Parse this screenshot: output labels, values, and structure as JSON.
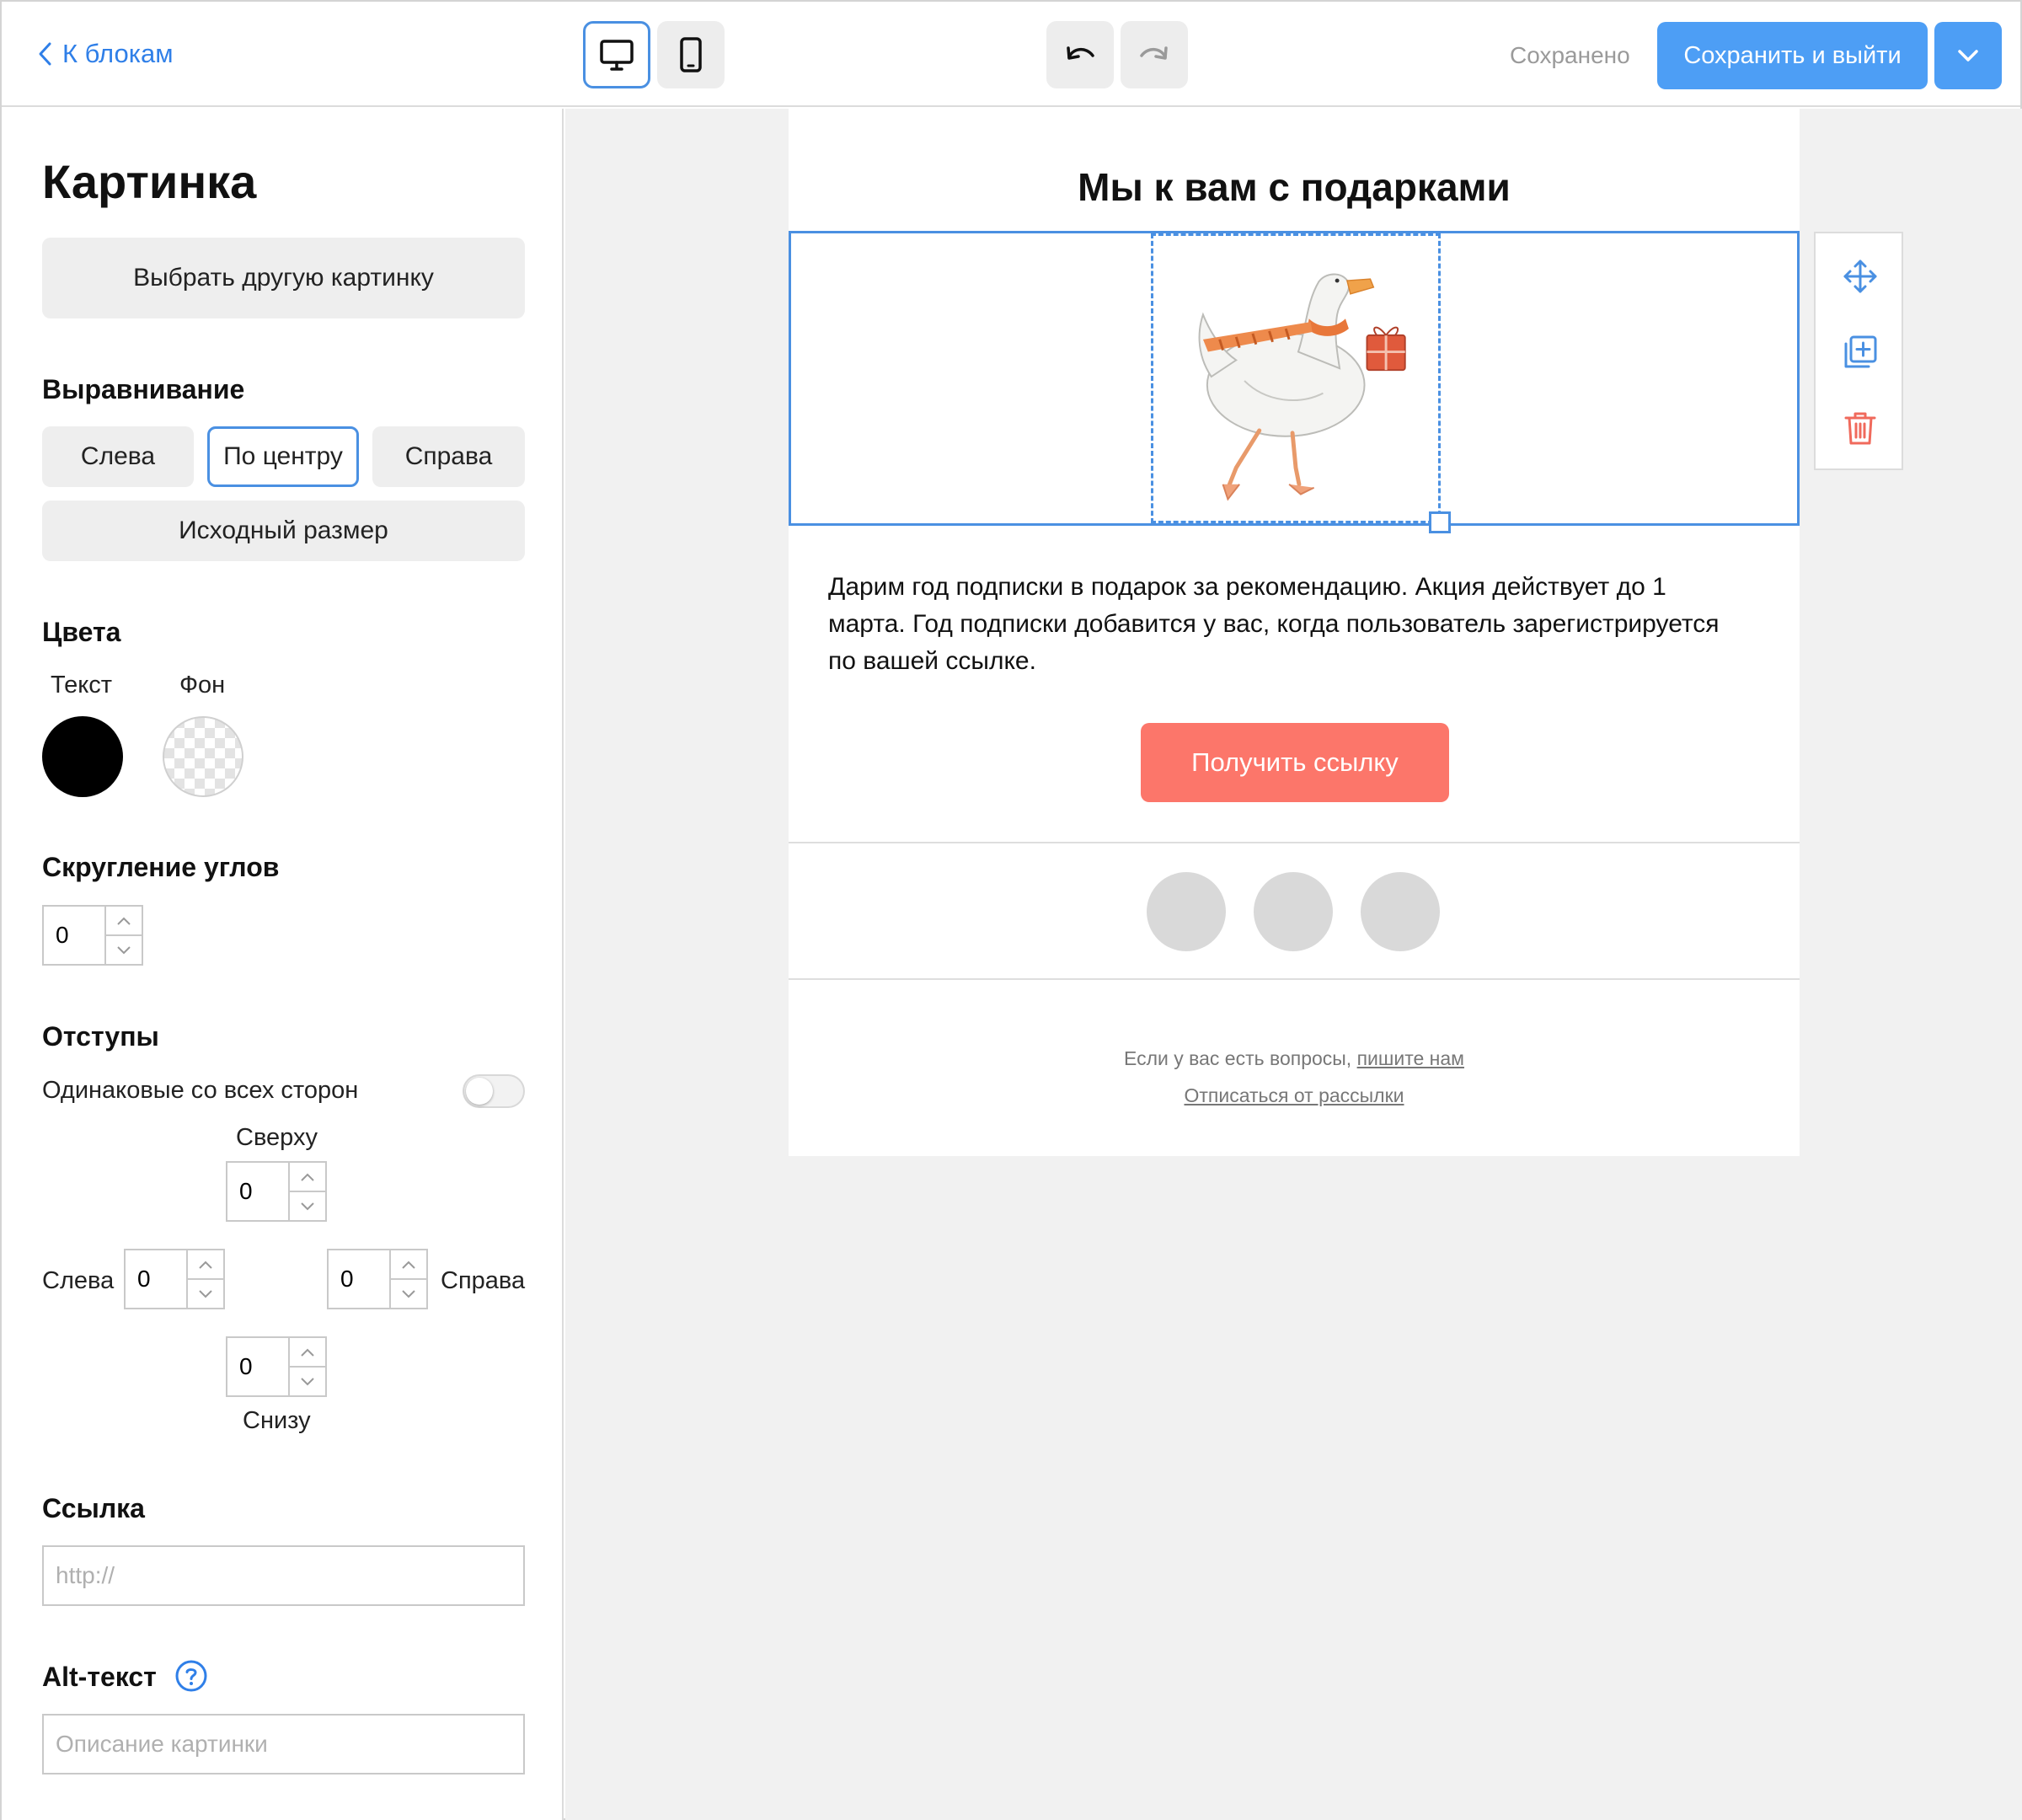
{
  "topbar": {
    "back_label": "К блокам",
    "saved_status": "Сохранено",
    "save_exit_label": "Сохранить и выйти",
    "accent_color": "#4d9ef5"
  },
  "sidebar": {
    "title": "Картинка",
    "choose_image_label": "Выбрать другую картинку",
    "alignment": {
      "title": "Выравнивание",
      "left": "Слева",
      "center": "По центру",
      "right": "Справа",
      "selected": "По центру",
      "original_size": "Исходный размер"
    },
    "colors": {
      "title": "Цвета",
      "text_label": "Текст",
      "bg_label": "Фон",
      "text_color": "#000000"
    },
    "corner_radius": {
      "title": "Скругление углов",
      "value": "0"
    },
    "padding": {
      "title": "Отступы",
      "same_all_sides": "Одинаковые со всех сторон",
      "same_all_sides_enabled": false,
      "top_label": "Сверху",
      "top": "0",
      "left_label": "Слева",
      "left": "0",
      "right_label": "Справа",
      "right": "0",
      "bottom_label": "Снизу",
      "bottom": "0"
    },
    "link": {
      "title": "Ссылка",
      "placeholder": "http://",
      "value": ""
    },
    "alt": {
      "title": "Alt-текст",
      "placeholder": "Описание картинки",
      "value": ""
    }
  },
  "email": {
    "title": "Мы к вам с подарками",
    "body": "Дарим год подписки в подарок за рекомендацию. Акция действует до 1 марта. Год подписки добавится у вас, когда пользователь зарегистрируется по вашей ссылке.",
    "cta_label": "Получить ссылку",
    "cta_color": "#fc766a",
    "footer_question": "Если у вас есть вопросы, ",
    "footer_contact_link": "пишите нам",
    "unsubscribe_link": "Отписаться от рассылки"
  }
}
